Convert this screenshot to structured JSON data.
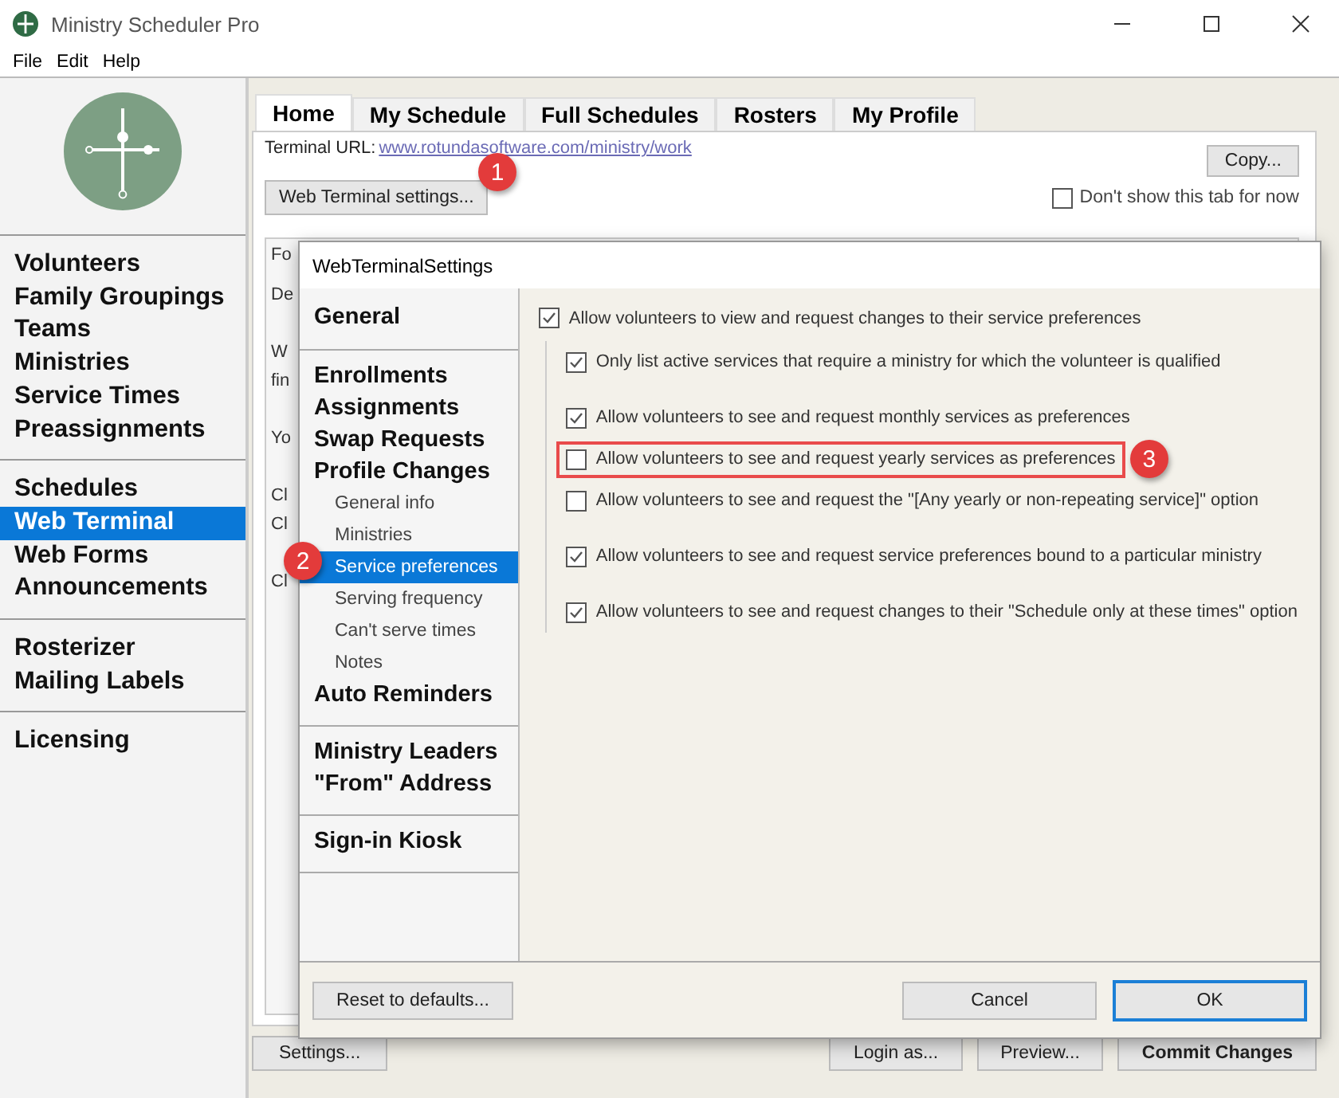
{
  "window": {
    "title": "Ministry Scheduler Pro"
  },
  "menu": [
    "File",
    "Edit",
    "Help"
  ],
  "sidebar": {
    "groups": [
      {
        "items": [
          {
            "label": "Volunteers",
            "selected": false
          },
          {
            "label": "Family Groupings",
            "selected": false
          },
          {
            "label": "Teams",
            "selected": false
          },
          {
            "label": "Ministries",
            "selected": false
          },
          {
            "label": "Service Times",
            "selected": false
          },
          {
            "label": "Preassignments",
            "selected": false
          }
        ]
      },
      {
        "items": [
          {
            "label": "Schedules",
            "selected": false
          },
          {
            "label": "Web Terminal",
            "selected": true
          },
          {
            "label": "Web Forms",
            "selected": false
          },
          {
            "label": "Announcements",
            "selected": false
          }
        ]
      },
      {
        "items": [
          {
            "label": "Rosterizer",
            "selected": false
          },
          {
            "label": "Mailing Labels",
            "selected": false
          }
        ]
      },
      {
        "items": [
          {
            "label": "Licensing",
            "selected": false
          }
        ]
      }
    ]
  },
  "tabs": [
    {
      "label": "Home",
      "selected": true
    },
    {
      "label": "My Schedule",
      "selected": false
    },
    {
      "label": "Full Schedules",
      "selected": false
    },
    {
      "label": "Rosters",
      "selected": false
    },
    {
      "label": "My Profile",
      "selected": false
    }
  ],
  "home": {
    "url_label": "Terminal URL:",
    "url": "www.rotundasoftware.com/ministry/work",
    "copy_button": "Copy...",
    "settings_button": "Web Terminal settings...",
    "hide_tab": {
      "label": "Don't show this tab for now",
      "checked": false
    },
    "covered_fragments": [
      "Fo",
      "De",
      "W",
      "fin",
      "Yo",
      "Cl",
      "Cl",
      "Cl"
    ]
  },
  "bottom_buttons": [
    {
      "label": "Settings...",
      "kind": "plain"
    },
    {
      "label": "Login as...",
      "kind": "plain"
    },
    {
      "label": "Preview...",
      "kind": "plain"
    },
    {
      "label": "Commit Changes",
      "kind": "strong"
    }
  ],
  "dialog": {
    "title": "WebTerminalSettings",
    "nav_groups": [
      {
        "items": [
          {
            "label": "General",
            "selected": false
          }
        ]
      },
      {
        "items": [
          {
            "label": "Enrollments",
            "selected": false
          },
          {
            "label": "Assignments",
            "selected": false
          },
          {
            "label": "Swap Requests",
            "selected": false
          },
          {
            "label": "Profile Changes",
            "selected": false,
            "children": [
              {
                "label": "General info",
                "selected": false
              },
              {
                "label": "Ministries",
                "selected": false
              },
              {
                "label": "Service preferences",
                "selected": true
              },
              {
                "label": "Serving frequency",
                "selected": false
              },
              {
                "label": "Can't serve times",
                "selected": false
              },
              {
                "label": "Notes",
                "selected": false
              }
            ]
          },
          {
            "label": "Auto Reminders",
            "selected": false
          }
        ]
      },
      {
        "items": [
          {
            "label": "Ministry Leaders",
            "selected": false
          },
          {
            "label": "\"From\" Address",
            "selected": false
          }
        ]
      },
      {
        "items": [
          {
            "label": "Sign-in Kiosk",
            "selected": false
          }
        ]
      }
    ],
    "options": [
      {
        "label": "Allow volunteers to view and request changes to their service preferences",
        "checked": true,
        "children": [
          {
            "label": "Only list active services that require a ministry for which the volunteer is qualified",
            "checked": true,
            "highlighted": false
          },
          {
            "label": "Allow volunteers to see and request monthly services as preferences",
            "checked": true,
            "highlighted": false
          },
          {
            "label": "Allow volunteers to see and request yearly services as preferences",
            "checked": false,
            "highlighted": true
          },
          {
            "label": "Allow volunteers to see and request the \"[Any yearly or non-repeating service]\" option",
            "checked": false,
            "highlighted": false
          },
          {
            "label": "Allow volunteers to see and request service preferences bound to a particular ministry",
            "checked": true,
            "highlighted": false
          },
          {
            "label": "Allow volunteers to see and request changes to their \"Schedule only at these times\" option",
            "checked": true,
            "highlighted": false
          }
        ]
      }
    ],
    "left_button": "Reset to defaults...",
    "buttons": [
      {
        "label": "Cancel",
        "default": false
      },
      {
        "label": "OK",
        "default": true
      }
    ]
  },
  "callouts": [
    {
      "number": "1"
    },
    {
      "number": "2"
    },
    {
      "number": "3"
    }
  ]
}
